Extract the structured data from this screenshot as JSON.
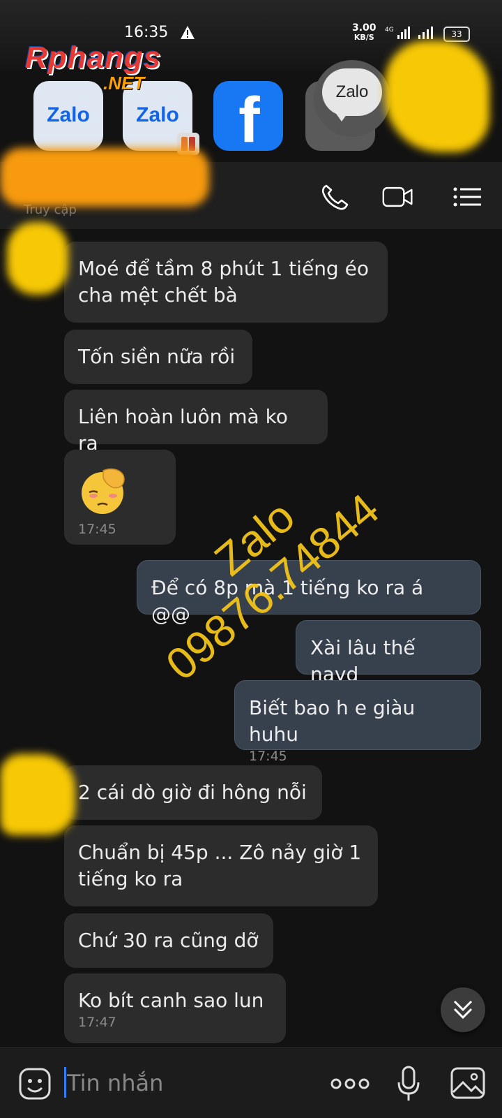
{
  "status_bar": {
    "time": "16:35",
    "net_speed_value": "3.00",
    "net_speed_unit": "KB/S",
    "network": "4G",
    "battery": "33"
  },
  "overlay": {
    "logo_main": "Rphangs",
    "logo_sub": ".NET",
    "apps": [
      {
        "label": "Zalo",
        "icon": "zalo-icon"
      },
      {
        "label": "Zalo",
        "icon": "zalo-icon"
      },
      {
        "label": "f",
        "icon": "facebook-icon"
      }
    ],
    "floating_bubble": "Zalo",
    "watermark_line1": "Zalo",
    "watermark_line2": "09876.74844"
  },
  "header": {
    "subtitle": "Truy cập",
    "icons": [
      "phone-icon",
      "video-call-icon",
      "menu-icon"
    ]
  },
  "messages": [
    {
      "dir": "in",
      "lines": [
        "Moé để tầm 8 phút 1 tiếng éo",
        "cha mệt chết bà"
      ]
    },
    {
      "dir": "in",
      "lines": [
        "Tốn siền nữa rồi"
      ]
    },
    {
      "dir": "in",
      "lines": [
        "Liên hoàn luôn mà ko ra"
      ]
    },
    {
      "dir": "in",
      "sticker": "facepalm-emoji",
      "time": "17:45"
    },
    {
      "dir": "out",
      "lines": [
        "Để có 8p mà 1 tiếng ko ra á @@"
      ]
    },
    {
      "dir": "out",
      "lines": [
        "Xài lâu thế nayd"
      ]
    },
    {
      "dir": "out",
      "lines": [
        "Biết bao h e giàu huhu"
      ],
      "time": "17:45"
    },
    {
      "dir": "in",
      "lines": [
        "2 cái dò giờ đi hông nỗi"
      ]
    },
    {
      "dir": "in",
      "lines": [
        "Chuẩn bị 45p ... Zô nảy giờ 1",
        "tiếng ko ra"
      ]
    },
    {
      "dir": "in",
      "lines": [
        "Chứ 30 ra cũng dỡ"
      ]
    },
    {
      "dir": "in",
      "lines": [
        "Ko bít canh sao lun"
      ],
      "time": "17:47"
    }
  ],
  "input": {
    "placeholder": "Tin nhắn"
  },
  "colors": {
    "background": "#121212",
    "incoming_bubble": "#2c2c2c",
    "outgoing_bubble": "#37404d",
    "watermark": "#f2c31a",
    "censor": "#f7c805"
  }
}
